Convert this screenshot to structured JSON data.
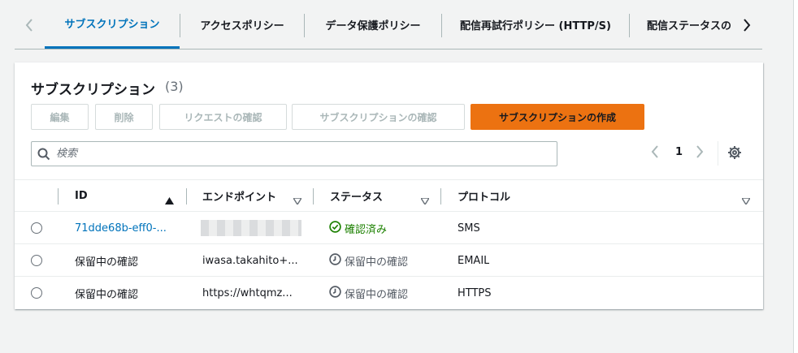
{
  "tabs": [
    {
      "label": "サブスクリプション",
      "active": true
    },
    {
      "label": "アクセスポリシー",
      "active": false
    },
    {
      "label": "データ保護ポリシー",
      "active": false
    },
    {
      "label": "配信再試行ポリシー (HTTP/S)",
      "active": false
    },
    {
      "label": "配信ステータスの",
      "active": false
    }
  ],
  "panel": {
    "title": "サブスクリプション",
    "count": "(3)",
    "buttons": {
      "edit": "編集",
      "delete": "削除",
      "confirm_request": "リクエストの確認",
      "confirm_subscription": "サブスクリプションの確認",
      "create": "サブスクリプションの作成"
    },
    "search": {
      "placeholder": "検索",
      "value": ""
    },
    "pagination": {
      "page": "1"
    }
  },
  "table": {
    "columns": [
      "ID",
      "エンドポイント",
      "ステータス",
      "プロトコル"
    ],
    "rows": [
      {
        "id": "71dde68b-eff0-...",
        "endpoint": "",
        "status": "確認済み",
        "protocol": "SMS"
      },
      {
        "id": "保留中の確認",
        "endpoint": "iwasa.takahito+...",
        "status": "保留中の確認",
        "protocol": "EMAIL"
      },
      {
        "id": "保留中の確認",
        "endpoint": "https://whtqmz...",
        "status": "保留中の確認",
        "protocol": "HTTPS"
      }
    ]
  },
  "colors": {
    "accent": "#0073bb",
    "primary_button": "#ec7211",
    "success": "#1d8102",
    "muted": "#545b64"
  },
  "icons": {
    "tab_prev": "chevron-left-icon",
    "tab_next": "chevron-right-icon",
    "search": "search-icon",
    "settings": "gear-icon",
    "confirmed": "check-circle-icon",
    "pending": "clock-icon"
  }
}
